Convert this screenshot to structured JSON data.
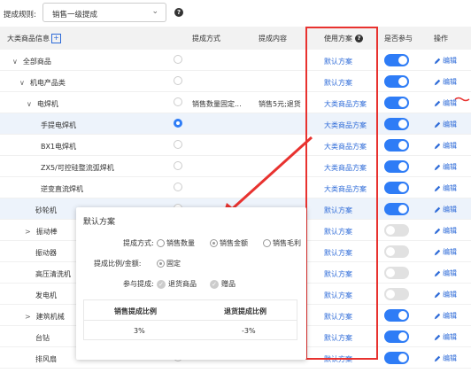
{
  "filter": {
    "label": "提成规则:",
    "selected": "销售一级提成"
  },
  "table": {
    "headers": {
      "category": "大类商品信息",
      "method": "提成方式",
      "content": "提成内容",
      "plan": "使用方案",
      "participate": "是否参与",
      "ops": "操作"
    },
    "rows": [
      {
        "name": "全部商品",
        "method": "",
        "content": "",
        "plan": "默认方案",
        "on": true,
        "expander": "∨"
      },
      {
        "name": "机电产品类",
        "method": "",
        "content": "",
        "plan": "默认方案",
        "on": true,
        "expander": "∨"
      },
      {
        "name": "电焊机",
        "method": "销售数量固定...",
        "content": "销售5元;退货",
        "plan": "大类商品方案",
        "on": true,
        "expander": "∨"
      },
      {
        "name": "手提电焊机",
        "method": "",
        "content": "",
        "plan": "大类商品方案",
        "on": true,
        "expander": ""
      },
      {
        "name": "BX1电焊机",
        "method": "",
        "content": "",
        "plan": "大类商品方案",
        "on": true,
        "expander": ""
      },
      {
        "name": "ZX5/可控硅整流弧焊机",
        "method": "",
        "content": "",
        "plan": "大类商品方案",
        "on": true,
        "expander": ""
      },
      {
        "name": "逆变直流焊机",
        "method": "",
        "content": "",
        "plan": "大类商品方案",
        "on": true,
        "expander": ""
      },
      {
        "name": "砂轮机",
        "method": "",
        "content": "",
        "plan": "默认方案",
        "on": true,
        "expander": ""
      },
      {
        "name": "振动棒",
        "method": "",
        "content": "",
        "plan": "默认方案",
        "on": false,
        "expander": ">"
      },
      {
        "name": "振动器",
        "method": "",
        "content": "",
        "plan": "默认方案",
        "on": false,
        "expander": ""
      },
      {
        "name": "高压清洗机",
        "method": "",
        "content": "",
        "plan": "默认方案",
        "on": false,
        "expander": ""
      },
      {
        "name": "发电机",
        "method": "",
        "content": "",
        "plan": "默认方案",
        "on": false,
        "expander": ""
      },
      {
        "name": "建筑机械",
        "method": "",
        "content": "",
        "plan": "默认方案",
        "on": true,
        "expander": ">"
      },
      {
        "name": "台钻",
        "method": "",
        "content": "",
        "plan": "默认方案",
        "on": true,
        "expander": ""
      },
      {
        "name": "排风扇",
        "method": "",
        "content": "",
        "plan": "默认方案",
        "on": true,
        "expander": ""
      }
    ],
    "edit_label": "编辑"
  },
  "popup": {
    "title": "默认方案",
    "method_label": "提成方式:",
    "method_options": [
      "销售数量",
      "销售金额",
      "销售毛利"
    ],
    "ratio_label": "提成比例/金额:",
    "ratio_option": "固定",
    "participate_label": "参与提成:",
    "participate_options": [
      "退货商品",
      "赠品"
    ],
    "table_headers": [
      "销售提成比例",
      "退货提成比例"
    ],
    "table_values": [
      "3%",
      "-3%"
    ]
  },
  "colors": {
    "accent": "#2e7cf6",
    "highlight": "#e8322f"
  }
}
